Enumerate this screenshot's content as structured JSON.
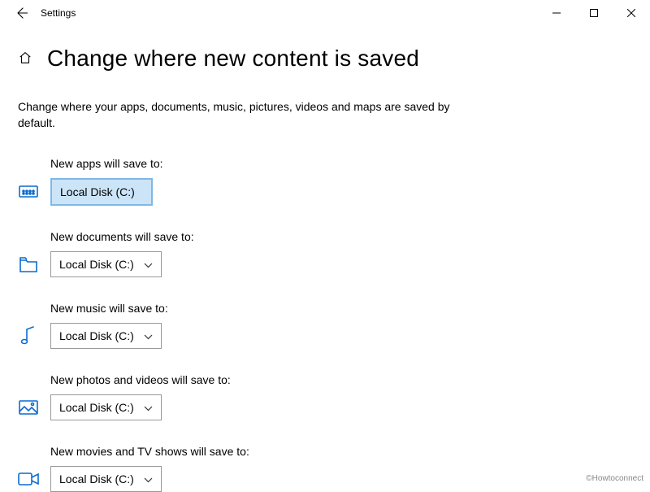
{
  "window": {
    "title": "Settings"
  },
  "page": {
    "heading": "Change where new content is saved",
    "description": "Change where your apps, documents, music, pictures, videos and maps are saved by default."
  },
  "settings": {
    "apps": {
      "label": "New apps will save to:",
      "value": "Local Disk (C:)"
    },
    "documents": {
      "label": "New documents will save to:",
      "value": "Local Disk (C:)"
    },
    "music": {
      "label": "New music will save to:",
      "value": "Local Disk (C:)"
    },
    "photos": {
      "label": "New photos and videos will save to:",
      "value": "Local Disk (C:)"
    },
    "movies": {
      "label": "New movies and TV shows will save to:",
      "value": "Local Disk (C:)"
    }
  },
  "watermark": "©Howtoconnect"
}
